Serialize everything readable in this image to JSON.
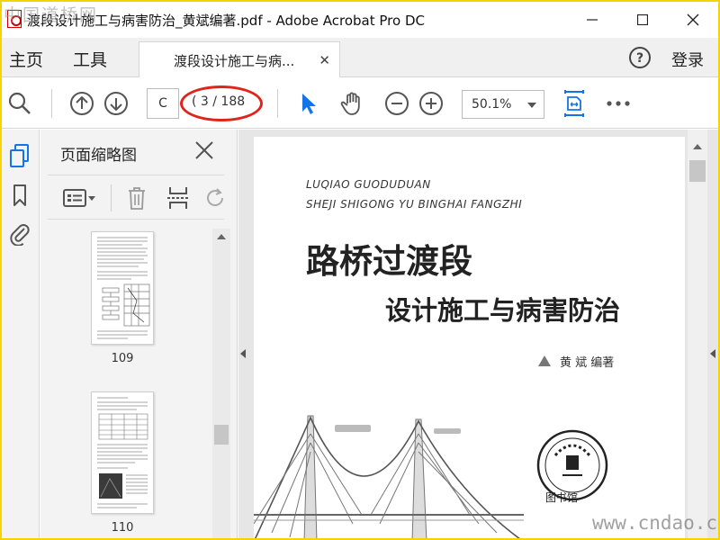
{
  "titlebar": {
    "title": "渡段设计施工与病害防治_黄斌编著.pdf - Adobe Acrobat Pro DC"
  },
  "menubar": {
    "home": "主页",
    "tools": "工具",
    "doc_tab": "渡段设计施工与病...",
    "login": "登录"
  },
  "toolbar": {
    "page_input": "C",
    "page_count": "( 3 / 188",
    "zoom": "50.1%"
  },
  "thumbnails": {
    "title": "页面缩略图",
    "pages": [
      {
        "label": "109"
      },
      {
        "label": "110"
      }
    ]
  },
  "document": {
    "roman_line1": "LUQIAO GUODUDUAN",
    "roman_line2": "SHEJI SHIGONG YU BINGHAI FANGZHI",
    "title_main": "路桥过渡段",
    "title_sub": "设计施工与病害防治",
    "author": "黄   斌   编著",
    "stamp_label": "图书馆"
  },
  "watermarks": {
    "top_left": "中国道桥网",
    "bottom_right": "www.cndao.com"
  },
  "colors": {
    "accent_blue": "#1473e6",
    "annotation_red": "#e0241b",
    "border_yellow": "#f5d400"
  }
}
